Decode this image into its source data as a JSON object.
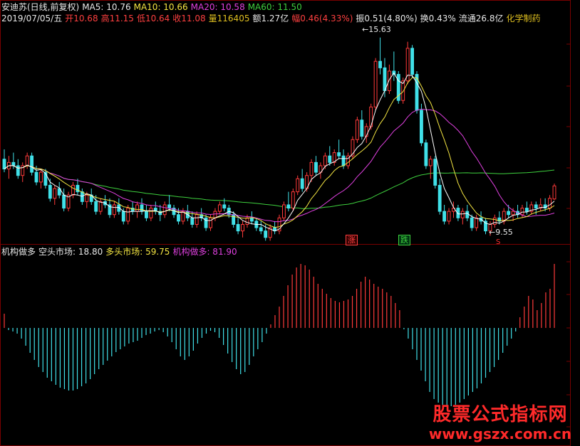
{
  "info": {
    "stock": "安迪苏(日线,前复权)",
    "ma5": "MA5: 10.76",
    "ma10": "MA10: 10.66",
    "ma20": "MA20: 10.58",
    "ma60": "MA60: 11.50",
    "date": "2019/07/05/五",
    "open": "开10.68",
    "high": "高11.15",
    "low": "低10.64",
    "close": "收11.08",
    "volume": "量116405",
    "amount": "额1.27亿",
    "range": "幅0.46(4.33%)",
    "amplitude": "振0.51(4.80%)",
    "turnover": "换0.43%",
    "float": "流通26.8亿",
    "sector": "化学制药"
  },
  "indicator": {
    "name": "机构做多",
    "bear": "空头市场: 18.80",
    "bull": "多头市场: 59.75",
    "inst": "机构做多: 81.90"
  },
  "markers": {
    "high": "15.63",
    "low": "9.55",
    "zhang": "涨",
    "die": "跌",
    "s": "S"
  },
  "watermark": {
    "title": "股票公式指标网",
    "url": "www.gszx.com.cn"
  },
  "colors": {
    "up": "#ff3a3a",
    "down": "#40e0e8",
    "ma5": "#ffffff",
    "ma10": "#f5e642",
    "ma20": "#e040e0",
    "ma60": "#3ed13e",
    "grid": "#7a0000"
  },
  "chart_data": [
    {
      "type": "candlestick",
      "title": "安迪苏(日线,前复权)",
      "ylim": [
        9.3,
        16.3
      ],
      "candles": [
        [
          11.9,
          12.2,
          11.5,
          11.6
        ],
        [
          11.6,
          12.0,
          11.3,
          11.8
        ],
        [
          11.8,
          12.1,
          11.6,
          11.7
        ],
        [
          11.7,
          11.9,
          11.3,
          11.4
        ],
        [
          11.4,
          11.8,
          11.2,
          11.7
        ],
        [
          11.7,
          12.1,
          11.6,
          12.0
        ],
        [
          12.0,
          12.1,
          11.4,
          11.5
        ],
        [
          11.5,
          11.7,
          11.1,
          11.2
        ],
        [
          11.2,
          11.6,
          11.0,
          11.5
        ],
        [
          11.5,
          11.6,
          11.0,
          11.1
        ],
        [
          11.1,
          11.3,
          10.6,
          10.7
        ],
        [
          10.7,
          11.1,
          10.5,
          11.0
        ],
        [
          11.0,
          11.2,
          10.7,
          10.8
        ],
        [
          10.8,
          11.0,
          10.3,
          10.4
        ],
        [
          10.4,
          10.9,
          10.3,
          10.8
        ],
        [
          10.8,
          11.2,
          10.7,
          11.1
        ],
        [
          11.1,
          11.3,
          10.8,
          10.9
        ],
        [
          10.9,
          11.0,
          10.5,
          10.6
        ],
        [
          10.6,
          10.9,
          10.4,
          10.8
        ],
        [
          10.8,
          11.0,
          10.5,
          10.6
        ],
        [
          10.6,
          10.8,
          10.2,
          10.3
        ],
        [
          10.3,
          10.7,
          10.2,
          10.6
        ],
        [
          10.6,
          10.8,
          10.4,
          10.5
        ],
        [
          10.5,
          10.7,
          10.1,
          10.2
        ],
        [
          10.2,
          10.6,
          10.1,
          10.5
        ],
        [
          10.5,
          10.7,
          10.2,
          10.3
        ],
        [
          10.3,
          10.4,
          9.9,
          10.0
        ],
        [
          10.0,
          10.5,
          9.9,
          10.4
        ],
        [
          10.4,
          10.6,
          10.2,
          10.3
        ],
        [
          10.3,
          10.6,
          10.1,
          10.5
        ],
        [
          10.5,
          10.7,
          10.2,
          10.3
        ],
        [
          10.3,
          10.5,
          10.0,
          10.1
        ],
        [
          10.1,
          10.5,
          10.0,
          10.4
        ],
        [
          10.4,
          10.6,
          10.2,
          10.3
        ],
        [
          10.3,
          10.5,
          10.0,
          10.2
        ],
        [
          10.2,
          10.6,
          10.1,
          10.5
        ],
        [
          10.5,
          10.8,
          10.3,
          10.4
        ],
        [
          10.4,
          10.5,
          10.1,
          10.2
        ],
        [
          10.2,
          10.4,
          9.9,
          10.0
        ],
        [
          10.0,
          10.4,
          9.9,
          10.3
        ],
        [
          10.3,
          10.5,
          10.0,
          10.1
        ],
        [
          10.1,
          10.3,
          9.8,
          9.9
        ],
        [
          9.9,
          10.3,
          9.8,
          10.2
        ],
        [
          10.2,
          10.4,
          10.0,
          10.1
        ],
        [
          10.1,
          10.2,
          9.7,
          9.8
        ],
        [
          9.8,
          10.2,
          9.7,
          10.1
        ],
        [
          10.1,
          10.4,
          10.0,
          10.3
        ],
        [
          10.3,
          10.6,
          10.2,
          10.5
        ],
        [
          10.5,
          10.7,
          10.3,
          10.4
        ],
        [
          10.4,
          10.5,
          10.1,
          10.2
        ],
        [
          10.2,
          10.3,
          9.8,
          9.9
        ],
        [
          9.9,
          10.1,
          9.6,
          9.7
        ],
        [
          9.7,
          10.0,
          9.5,
          9.9
        ],
        [
          9.9,
          10.2,
          9.8,
          10.1
        ],
        [
          10.1,
          10.3,
          9.9,
          10.0
        ],
        [
          10.0,
          10.1,
          9.7,
          9.8
        ],
        [
          9.8,
          10.0,
          9.6,
          9.7
        ],
        [
          9.7,
          9.9,
          9.4,
          9.5
        ],
        [
          9.5,
          9.9,
          9.4,
          9.8
        ],
        [
          9.8,
          10.0,
          9.6,
          9.7
        ],
        [
          9.7,
          10.2,
          9.6,
          10.1
        ],
        [
          10.1,
          10.6,
          10.0,
          10.5
        ],
        [
          10.5,
          10.9,
          10.3,
          10.4
        ],
        [
          10.4,
          11.0,
          10.3,
          10.9
        ],
        [
          10.9,
          11.4,
          10.8,
          11.3
        ],
        [
          11.3,
          11.6,
          10.9,
          11.0
        ],
        [
          11.0,
          11.5,
          10.9,
          11.4
        ],
        [
          11.4,
          11.9,
          11.2,
          11.8
        ],
        [
          11.8,
          12.0,
          11.4,
          11.5
        ],
        [
          11.5,
          11.8,
          11.3,
          11.7
        ],
        [
          11.7,
          12.1,
          11.6,
          12.0
        ],
        [
          12.0,
          12.3,
          11.7,
          11.8
        ],
        [
          11.8,
          12.2,
          11.7,
          12.1
        ],
        [
          12.1,
          12.5,
          11.9,
          12.0
        ],
        [
          12.0,
          12.2,
          11.6,
          11.7
        ],
        [
          11.7,
          12.1,
          11.6,
          12.0
        ],
        [
          12.0,
          12.6,
          11.9,
          12.5
        ],
        [
          12.5,
          13.2,
          12.4,
          13.1
        ],
        [
          13.1,
          13.4,
          12.5,
          12.6
        ],
        [
          12.6,
          13.0,
          12.4,
          12.9
        ],
        [
          12.9,
          13.6,
          12.8,
          13.5
        ],
        [
          13.5,
          15.0,
          13.4,
          14.9
        ],
        [
          14.9,
          15.63,
          14.5,
          14.7
        ],
        [
          14.7,
          15.0,
          13.8,
          14.0
        ],
        [
          14.0,
          14.8,
          13.9,
          14.6
        ],
        [
          14.6,
          15.2,
          14.3,
          14.5
        ],
        [
          14.5,
          14.6,
          13.6,
          13.7
        ],
        [
          13.7,
          14.4,
          13.6,
          14.3
        ],
        [
          14.3,
          15.5,
          14.2,
          15.3
        ],
        [
          15.3,
          15.4,
          14.4,
          14.5
        ],
        [
          14.5,
          14.6,
          13.3,
          13.4
        ],
        [
          13.4,
          13.6,
          12.3,
          12.4
        ],
        [
          12.4,
          12.5,
          11.6,
          11.7
        ],
        [
          11.7,
          12.0,
          11.3,
          11.9
        ],
        [
          11.9,
          12.0,
          11.0,
          11.1
        ],
        [
          11.1,
          11.3,
          10.2,
          10.3
        ],
        [
          10.3,
          10.5,
          9.9,
          10.0
        ],
        [
          10.0,
          10.4,
          9.9,
          10.3
        ],
        [
          10.3,
          10.6,
          10.1,
          10.4
        ],
        [
          10.4,
          10.5,
          10.0,
          10.1
        ],
        [
          10.1,
          10.4,
          9.9,
          10.3
        ],
        [
          10.3,
          10.5,
          10.0,
          10.1
        ],
        [
          10.1,
          10.2,
          9.7,
          9.8
        ],
        [
          9.8,
          10.2,
          9.7,
          10.1
        ],
        [
          10.1,
          10.3,
          9.9,
          10.0
        ],
        [
          10.0,
          10.1,
          9.6,
          9.7
        ],
        [
          9.7,
          10.0,
          9.55,
          9.9
        ],
        [
          9.9,
          10.2,
          9.8,
          10.1
        ],
        [
          10.1,
          10.3,
          9.9,
          10.0
        ],
        [
          10.0,
          10.4,
          9.9,
          10.3
        ],
        [
          10.3,
          10.5,
          10.1,
          10.2
        ],
        [
          10.2,
          10.4,
          10.0,
          10.3
        ],
        [
          10.3,
          10.5,
          10.1,
          10.2
        ],
        [
          10.2,
          10.5,
          10.1,
          10.4
        ],
        [
          10.4,
          10.6,
          10.2,
          10.3
        ],
        [
          10.3,
          10.6,
          10.2,
          10.5
        ],
        [
          10.5,
          10.6,
          10.2,
          10.4
        ],
        [
          10.4,
          10.7,
          10.3,
          10.5
        ],
        [
          10.5,
          10.7,
          10.3,
          10.4
        ],
        [
          10.4,
          10.8,
          10.3,
          10.7
        ],
        [
          10.68,
          11.15,
          10.64,
          11.08
        ]
      ]
    },
    {
      "type": "bar",
      "title": "机构做多",
      "ylim": [
        -100,
        100
      ],
      "values": [
        20,
        -3,
        -5,
        -8,
        -15,
        -25,
        -35,
        -45,
        -55,
        -62,
        -70,
        -75,
        -80,
        -84,
        -86,
        -88,
        -88,
        -86,
        -82,
        -78,
        -72,
        -65,
        -58,
        -52,
        -46,
        -40,
        -34,
        -30,
        -26,
        -22,
        -20,
        -18,
        -14,
        -10,
        -8,
        -5,
        -3,
        -6,
        -12,
        -20,
        -30,
        -40,
        -45,
        -40,
        -32,
        -22,
        -14,
        -8,
        -4,
        -6,
        -14,
        -24,
        -36,
        -48,
        -58,
        -65,
        -62,
        -52,
        -40,
        -30,
        -20,
        -8,
        5,
        18,
        30,
        45,
        60,
        75,
        85,
        90,
        88,
        82,
        72,
        62,
        55,
        48,
        42,
        38,
        36,
        38,
        40,
        45,
        55,
        65,
        72,
        68,
        62,
        58,
        55,
        50,
        45,
        35,
        25,
        -2,
        -15,
        -30,
        -45,
        -60,
        -75,
        -90,
        -100,
        -105,
        -108,
        -110,
        -110,
        -108,
        -105,
        -100,
        -95,
        -90,
        -85,
        -78,
        -70,
        -62,
        -55,
        -45,
        -35,
        -25,
        -15,
        -5,
        15,
        30,
        45,
        40,
        25,
        35,
        50,
        55,
        90
      ]
    }
  ]
}
